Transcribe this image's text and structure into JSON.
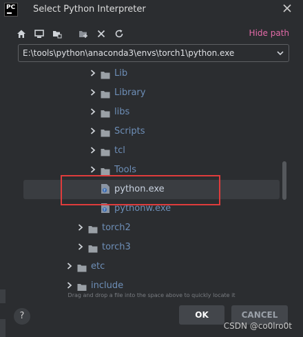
{
  "window": {
    "app_icon_text": "PC",
    "title": "Select Python Interpreter"
  },
  "toolbar": {
    "icons": [
      "home-icon",
      "desktop-icon",
      "project-folder-icon",
      "new-folder-icon",
      "delete-icon",
      "refresh-icon"
    ],
    "hide_path": "Hide path"
  },
  "path": {
    "value": "E:\\tools\\python\\anaconda3\\envs\\torch1\\python.exe"
  },
  "tree": {
    "items": [
      {
        "label": "Lib",
        "type": "folder",
        "expanded": false
      },
      {
        "label": "Library",
        "type": "folder",
        "expanded": false
      },
      {
        "label": "libs",
        "type": "folder",
        "expanded": false
      },
      {
        "label": "Scripts",
        "type": "folder",
        "expanded": false
      },
      {
        "label": "tcl",
        "type": "folder",
        "expanded": false
      },
      {
        "label": "Tools",
        "type": "folder",
        "expanded": false
      },
      {
        "label": "python.exe",
        "type": "file",
        "selected": true
      },
      {
        "label": "pythonw.exe",
        "type": "file"
      },
      {
        "label": "torch2",
        "type": "folder",
        "expanded": false
      },
      {
        "label": "torch3",
        "type": "folder",
        "expanded": false
      },
      {
        "label": "etc",
        "type": "folder",
        "expanded": false
      },
      {
        "label": "include",
        "type": "folder",
        "expanded": false
      }
    ]
  },
  "footer": {
    "hint": "Drag and drop a file into the space above to quickly locate it",
    "help": "?",
    "ok": "OK",
    "cancel": "CANCEL",
    "watermark": "CSDN @co0lro0t"
  },
  "colors": {
    "accent_pink": "#e36aa8",
    "highlight_red": "#e03c3c",
    "folder_blue": "#6e8fb8"
  }
}
